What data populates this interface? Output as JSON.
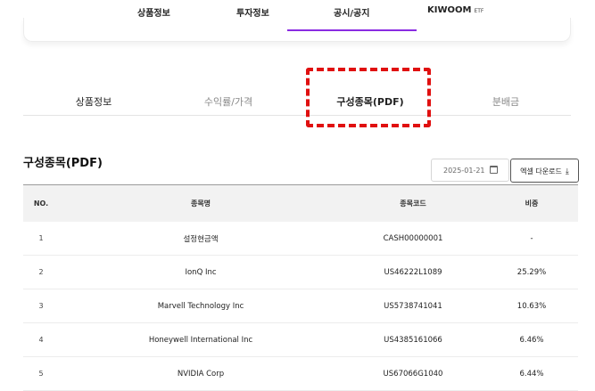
{
  "topnav": {
    "items": [
      "상품정보",
      "투자정보",
      "공시/공지",
      "KIWOOM"
    ],
    "brand_suffix": "ETF"
  },
  "tabs": [
    {
      "label": "상품정보",
      "active": false
    },
    {
      "label": "수익률/가격",
      "active": false
    },
    {
      "label": "구성종목(PDF)",
      "active": true
    },
    {
      "label": "분배금",
      "active": false
    }
  ],
  "section": {
    "title": "구성종목(PDF)",
    "date_value": "2025-01-21",
    "download_label": "엑셀 다운로드"
  },
  "table": {
    "headers": [
      "NO.",
      "종목명",
      "종목코드",
      "비중"
    ],
    "rows": [
      {
        "no": "1",
        "name": "설정현금액",
        "code": "CASH00000001",
        "weight": "-"
      },
      {
        "no": "2",
        "name": "IonQ Inc",
        "code": "US46222L1089",
        "weight": "25.29%"
      },
      {
        "no": "3",
        "name": "Marvell Technology Inc",
        "code": "US5738741041",
        "weight": "10.63%"
      },
      {
        "no": "4",
        "name": "Honeywell International Inc",
        "code": "US4385161066",
        "weight": "6.46%"
      },
      {
        "no": "5",
        "name": "NVIDIA Corp",
        "code": "US67066G1040",
        "weight": "6.44%"
      }
    ]
  },
  "colors": {
    "tab_underline": "#8a2be2",
    "highlight": "#e01010"
  }
}
